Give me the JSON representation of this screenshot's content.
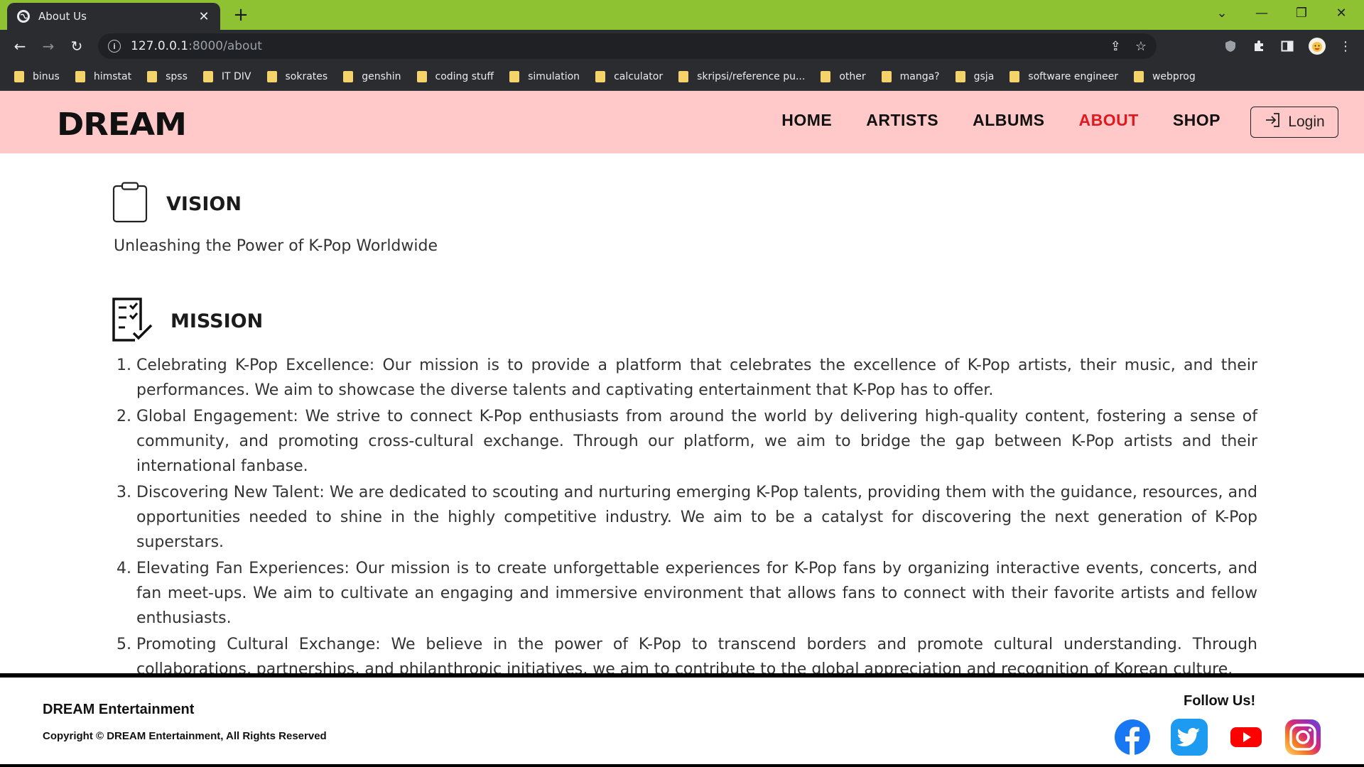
{
  "browser": {
    "tab_title": "About Us",
    "url_host": "127.0.0.1",
    "url_path": ":8000/about",
    "bookmarks": [
      "binus",
      "himstat",
      "spss",
      "IT DIV",
      "sokrates",
      "genshin",
      "coding stuff",
      "simulation",
      "calculator",
      "skripsi/reference pu...",
      "other",
      "manga?",
      "gsja",
      "software engineer",
      "webprog"
    ]
  },
  "site": {
    "logo": "DREAM",
    "nav": [
      "HOME",
      "ARTISTS",
      "ALBUMS",
      "ABOUT",
      "SHOP"
    ],
    "active_nav": "ABOUT",
    "login_label": "Login",
    "accent_color": "#e0191f",
    "header_bg": "#ffc9c9"
  },
  "vision": {
    "heading": "VISION",
    "text": "Unleashing the Power of K-Pop Worldwide"
  },
  "mission": {
    "heading": "MISSION",
    "items": [
      "Celebrating K-Pop Excellence: Our mission is to provide a platform that celebrates the excellence of K-Pop artists, their music, and their performances. We aim to showcase the diverse talents and captivating entertainment that K-Pop has to offer.",
      "Global Engagement: We strive to connect K-Pop enthusiasts from around the world by delivering high-quality content, fostering a sense of community, and promoting cross-cultural exchange. Through our platform, we aim to bridge the gap between K-Pop artists and their international fanbase.",
      "Discovering New Talent: We are dedicated to scouting and nurturing emerging K-Pop talents, providing them with the guidance, resources, and opportunities needed to shine in the highly competitive industry. We aim to be a catalyst for discovering the next generation of K-Pop superstars.",
      "Elevating Fan Experiences: Our mission is to create unforgettable experiences for K-Pop fans by organizing interactive events, concerts, and fan meet-ups. We aim to cultivate an engaging and immersive environment that allows fans to connect with their favorite artists and fellow enthusiasts.",
      "Promoting Cultural Exchange: We believe in the power of K-Pop to transcend borders and promote cultural understanding. Through collaborations, partnerships, and philanthropic initiatives, we aim to contribute to the global appreciation and recognition of Korean culture."
    ]
  },
  "footer": {
    "company": "DREAM Entertainment",
    "copyright": "Copyright © DREAM Entertainment, All Rights Reserved",
    "follow_label": "Follow Us!",
    "socials": [
      "facebook-icon",
      "twitter-icon",
      "youtube-icon",
      "instagram-icon"
    ]
  }
}
